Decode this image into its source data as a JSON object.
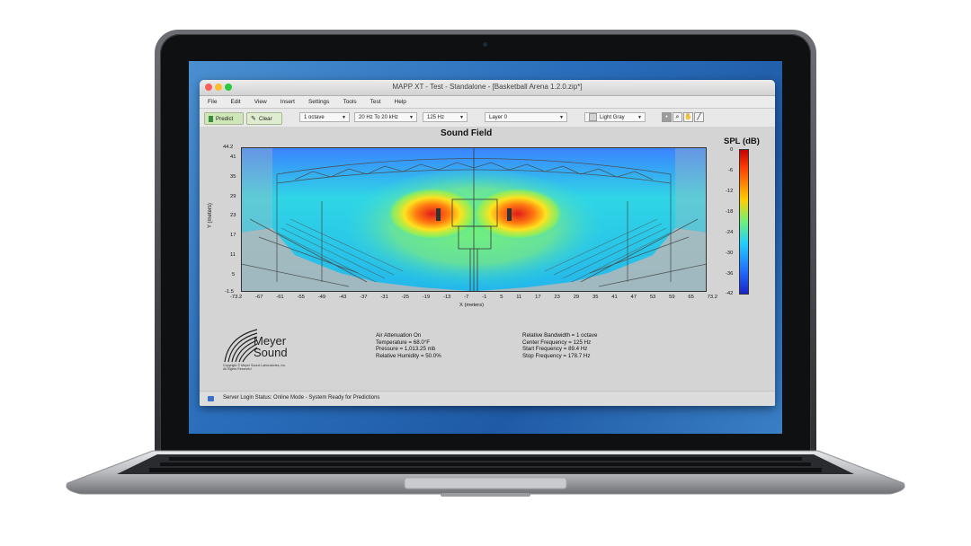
{
  "window": {
    "title": "MAPP XT - Test - Standalone - [Basketball Arena 1.2.0.zip*]"
  },
  "menu": [
    "File",
    "Edit",
    "View",
    "Insert",
    "Settings",
    "Tools",
    "Test",
    "Help"
  ],
  "toolbar": {
    "predict_label": "Predict",
    "clear_label": "Clear",
    "bandwidth": "1 octave",
    "range": "20 Hz To 20 kHz",
    "frequency": "125 Hz",
    "layer": "Layer 0",
    "color": "Light Gray"
  },
  "plot": {
    "title": "Sound Field",
    "xlabel": "X (meters)",
    "ylabel": "Y (meters)",
    "x_ticks": [
      "-73.2",
      "-67",
      "-61",
      "-55",
      "-49",
      "-43",
      "-37",
      "-31",
      "-25",
      "-19",
      "-13",
      "-7",
      "-1",
      "5",
      "11",
      "17",
      "23",
      "29",
      "35",
      "41",
      "47",
      "53",
      "59",
      "65",
      "73.2"
    ],
    "y_ticks": [
      "44.2",
      "41",
      "35",
      "29",
      "23",
      "17",
      "11",
      "5",
      "-1.5"
    ],
    "colorbar_title": "SPL (dB)",
    "colorbar_ticks": [
      "0",
      "-6",
      "-12",
      "-18",
      "-24",
      "-30",
      "-36",
      "-42"
    ]
  },
  "branding": {
    "name_line1": "Meyer",
    "name_line2": "Sound",
    "copyright_line1": "Copyright © Meyer Sound Laboratories, Inc.",
    "copyright_line2": "All Rights Reserved"
  },
  "atmosphere": {
    "line1": "Air Attenuation On",
    "line2": "Temperature = 68.0°F",
    "line3": "Pressure = 1,013.25  mb",
    "line4": "Relative Humidity = 50.0%"
  },
  "frequency_info": {
    "line1": "Relative Bandwidth = 1 octave",
    "line2": "Center Frequency = 125 Hz",
    "line3": "Start Frequency = 89.4 Hz",
    "line4": "Stop Frequency = 178.7 Hz"
  },
  "status": {
    "text": "Server Login Status: Online Mode - System Ready for Predictions"
  },
  "colors": {
    "predict_bg": "#cfe6b8",
    "desktop": "#2a6ebb",
    "plot_bg": "#d4d4d4"
  }
}
